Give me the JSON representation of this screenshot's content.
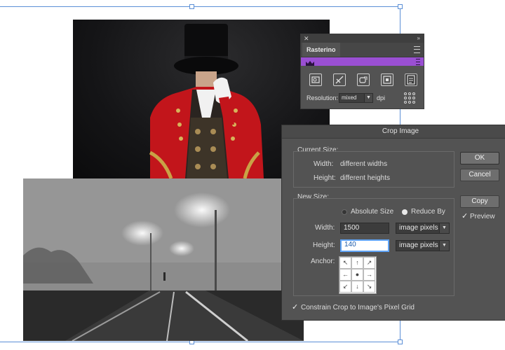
{
  "rasterino": {
    "title": "Rasterino",
    "resolution_label": "Resolution:",
    "resolution_value": "mixed",
    "resolution_unit": "dpi",
    "accent_color": "#9a4fd3"
  },
  "crop_dialog": {
    "title": "Crop Image",
    "current_size": {
      "legend": "Current Size:",
      "width_label": "Width:",
      "width_value": "different widths",
      "height_label": "Height:",
      "height_value": "different heights"
    },
    "new_size": {
      "legend": "New Size:",
      "absolute_size_label": "Absolute Size",
      "reduce_by_label": "Reduce By",
      "selected_mode": "Reduce By",
      "width_label": "Width:",
      "width_value": "1500",
      "width_unit": "image pixels",
      "height_label": "Height:",
      "height_value": "140",
      "height_unit": "image pixels",
      "anchor_label": "Anchor:"
    },
    "buttons": {
      "ok": "OK",
      "cancel": "Cancel",
      "copy": "Copy"
    },
    "preview_label": "Preview",
    "preview_checked": true,
    "constrain_label": "Constrain Crop to Image's Pixel Grid",
    "constrain_checked": true
  }
}
